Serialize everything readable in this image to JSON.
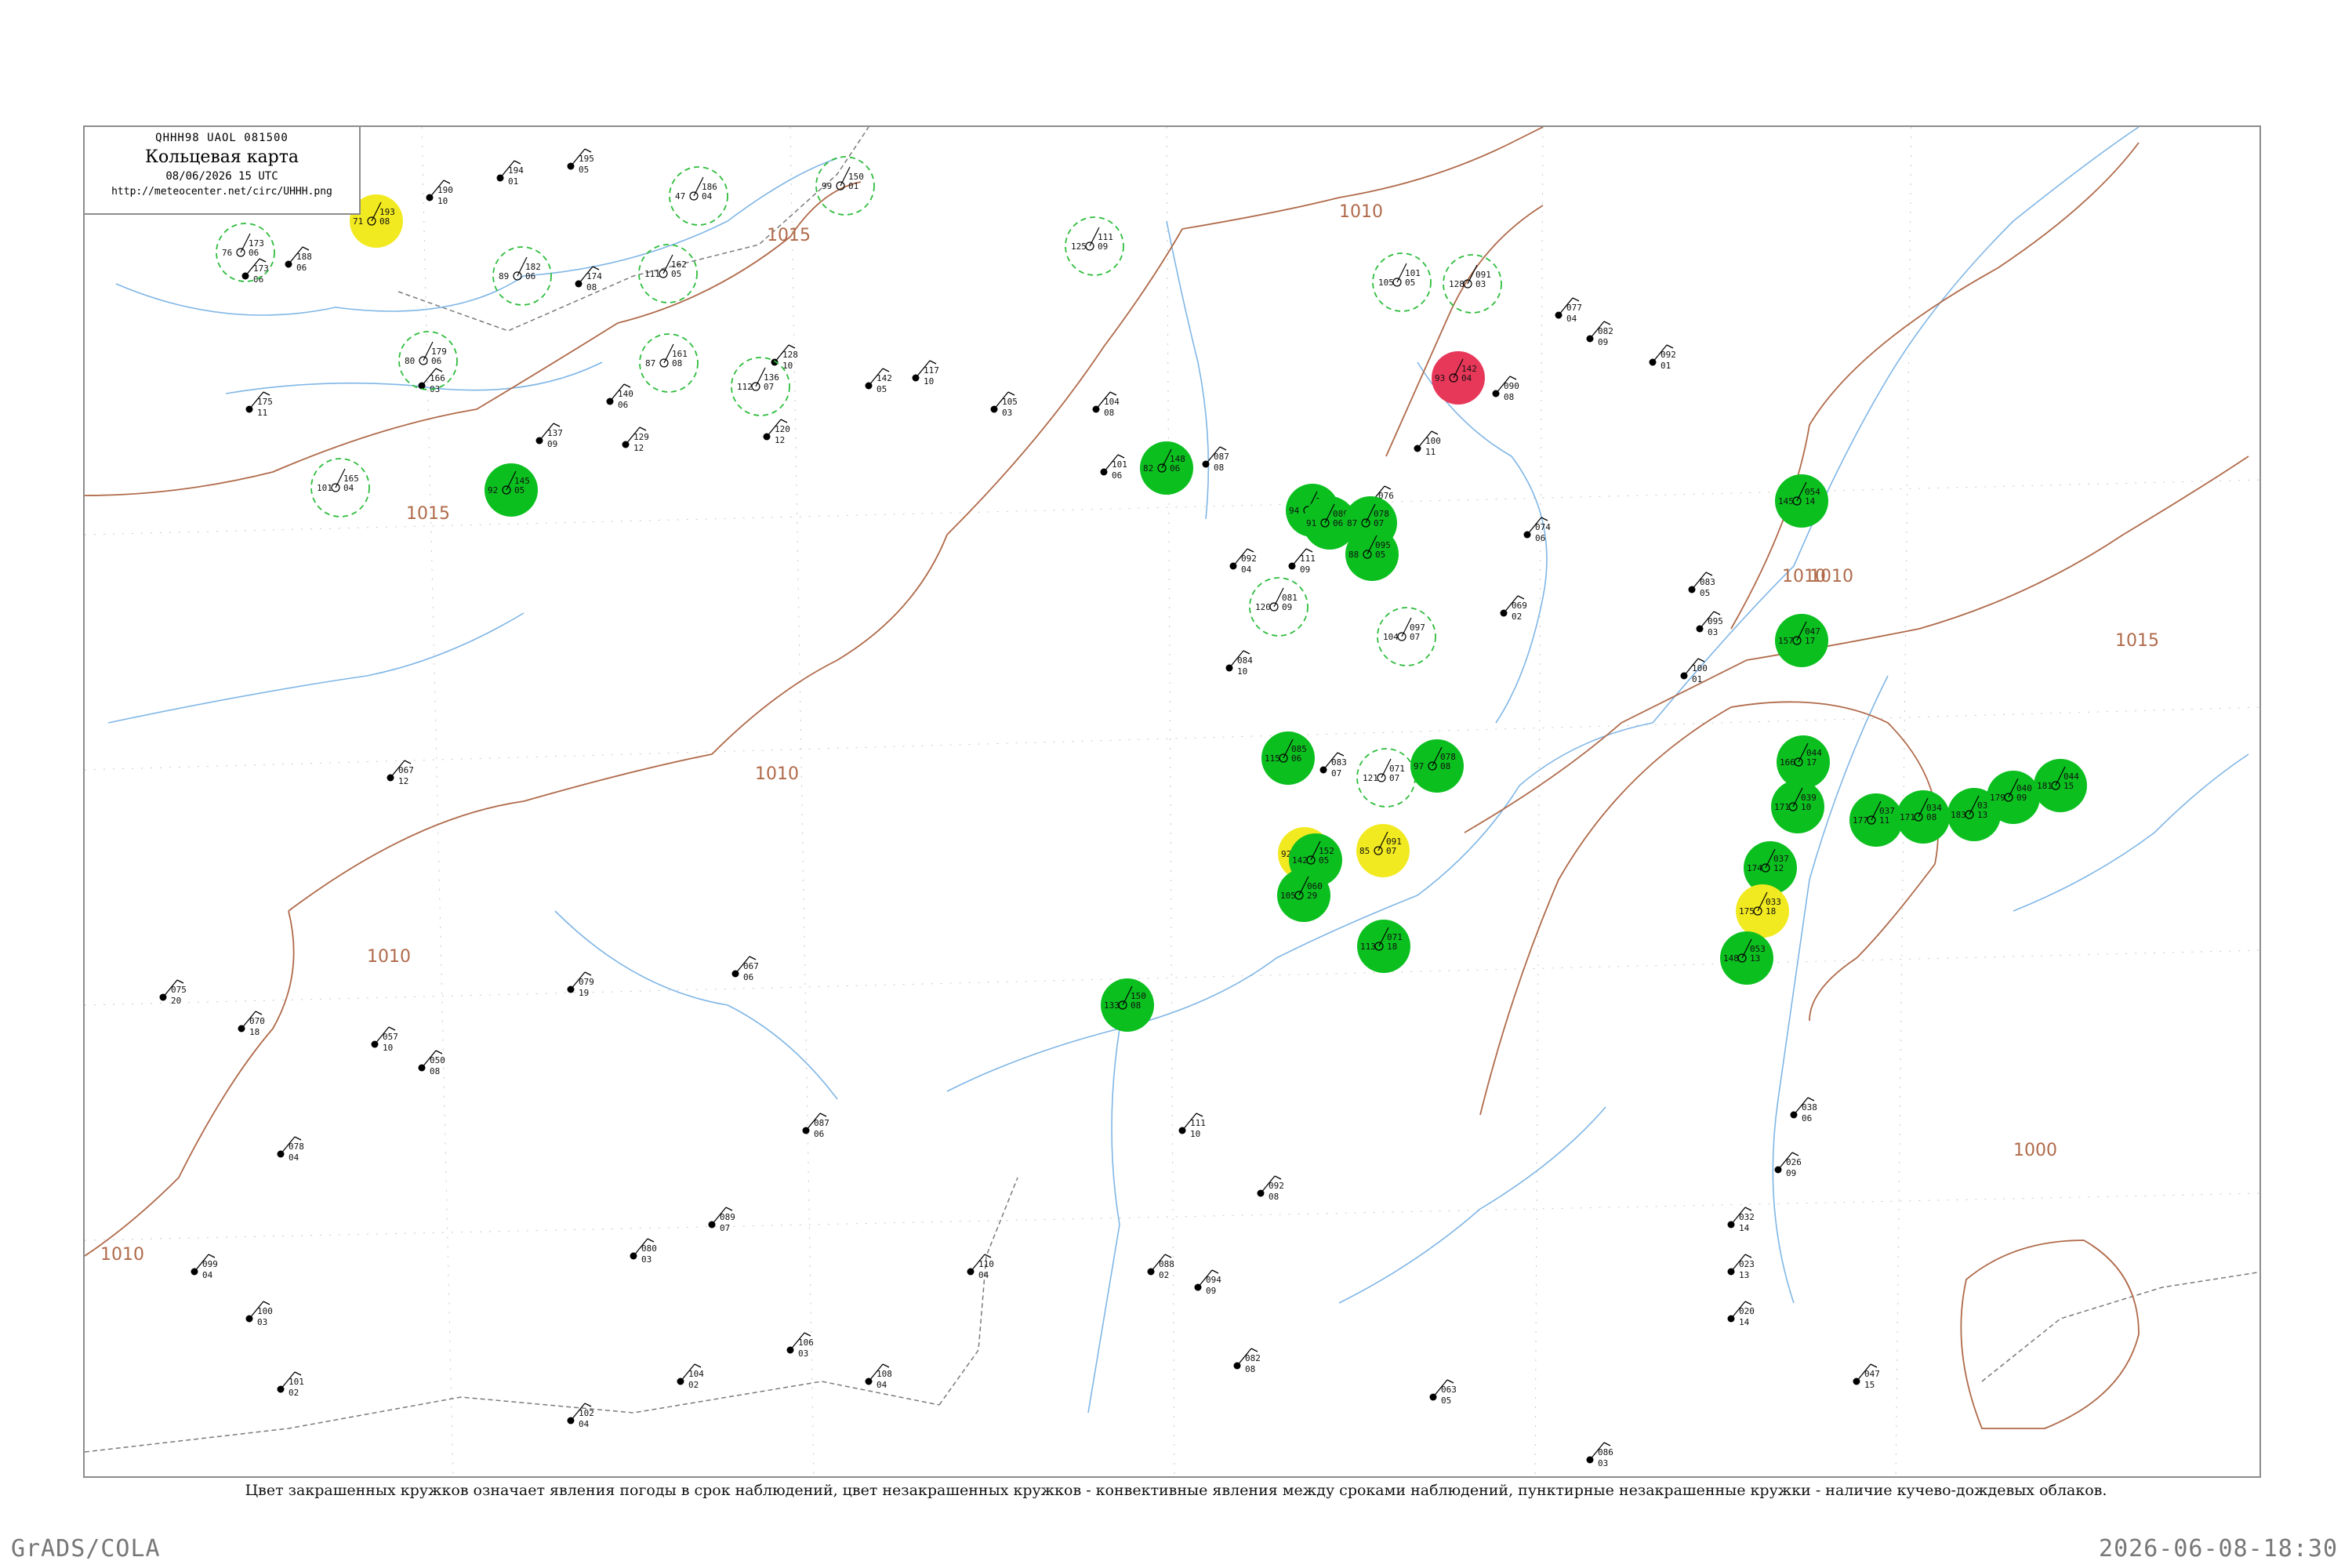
{
  "header": {
    "code": "QHHH98  UAOL  081500",
    "title": "Кольцевая карта",
    "datetime": "08/06/2026 15 UTC",
    "url": "http://meteocenter.net/circ/UHHH.png"
  },
  "footnote": "Цвет закрашенных кружков означает явления погоды в срок наблюдений, цвет незакрашенных кружков - конвективные явления между сроками наблюдений, пунктирные незакрашенные кружки - наличие кучево-дождевых облаков.",
  "footer": {
    "left": "GrADS/COLA",
    "right": "2026-06-08-18:30"
  },
  "colors": {
    "isobar": "#b06a4a",
    "river": "#7fb6e6",
    "border": "#7a7a7a",
    "precip_green": "#0bbf1f",
    "haze_yellow": "#f2ea20",
    "thunder_red": "#e8385a",
    "cb_dashed": "#2ebd3c"
  },
  "isobar_labels": [
    "1015",
    "1015",
    "1010",
    "1010",
    "1010",
    "1010",
    "1010",
    "1015",
    "1000",
    "1010"
  ],
  "stations": [
    {
      "pressure": "193",
      "temp": "08",
      "dew": "71",
      "state": "haze"
    },
    {
      "pressure": "173",
      "temp": "06",
      "dew": "76",
      "state": "cb"
    },
    {
      "pressure": "186",
      "temp": "04",
      "dew": "47",
      "state": "cb"
    },
    {
      "pressure": "150",
      "temp": "01",
      "dew": "99",
      "state": "cb"
    },
    {
      "pressure": "111",
      "temp": "09",
      "dew": "125",
      "state": "cb"
    },
    {
      "pressure": "101",
      "temp": "05",
      "dew": "105",
      "state": "cb"
    },
    {
      "pressure": "091",
      "temp": "03",
      "dew": "128",
      "state": "cb"
    },
    {
      "pressure": "179",
      "temp": "06",
      "dew": "80",
      "state": "cb"
    },
    {
      "pressure": "182",
      "temp": "06",
      "dew": "89",
      "state": "cb"
    },
    {
      "pressure": "162",
      "temp": "05",
      "dew": "111",
      "state": "cb"
    },
    {
      "pressure": "161",
      "temp": "08",
      "dew": "87",
      "state": "cb"
    },
    {
      "pressure": "136",
      "temp": "07",
      "dew": "112",
      "state": "cb"
    },
    {
      "pressure": "165",
      "temp": "04",
      "dew": "101",
      "state": "cb"
    },
    {
      "pressure": "142",
      "temp": "04",
      "dew": "93",
      "state": "thunder"
    },
    {
      "pressure": "145",
      "temp": "05",
      "dew": "92",
      "state": "precip"
    },
    {
      "pressure": "148",
      "temp": "06",
      "dew": "82",
      "state": "precip"
    },
    {
      "pressure": "149",
      "temp": "04",
      "dew": "94",
      "state": "precip"
    },
    {
      "pressure": "089",
      "temp": "06",
      "dew": "91",
      "state": "precip"
    },
    {
      "pressure": "078",
      "temp": "07",
      "dew": "87",
      "state": "precip"
    },
    {
      "pressure": "081",
      "temp": "09",
      "dew": "120",
      "state": "cb"
    },
    {
      "pressure": "097",
      "temp": "07",
      "dew": "104",
      "state": "cb"
    },
    {
      "pressure": "095",
      "temp": "05",
      "dew": "88",
      "state": "precip"
    },
    {
      "pressure": "085",
      "temp": "06",
      "dew": "115",
      "state": "precip"
    },
    {
      "pressure": "071",
      "temp": "07",
      "dew": "121",
      "state": "cb"
    },
    {
      "pressure": "078",
      "temp": "08",
      "dew": "97",
      "state": "precip"
    },
    {
      "pressure": "098",
      "temp": "05",
      "dew": "92",
      "state": "haze"
    },
    {
      "pressure": "091",
      "temp": "07",
      "dew": "85",
      "state": "haze"
    },
    {
      "pressure": "152",
      "temp": "05",
      "dew": "142",
      "state": "precip"
    },
    {
      "pressure": "150",
      "temp": "08",
      "dew": "133",
      "state": "precip"
    },
    {
      "pressure": "060",
      "temp": "29",
      "dew": "105",
      "state": "precip"
    },
    {
      "pressure": "071",
      "temp": "18",
      "dew": "113",
      "state": "precip"
    },
    {
      "pressure": "054",
      "temp": "14",
      "dew": "145",
      "state": "precip"
    },
    {
      "pressure": "047",
      "temp": "17",
      "dew": "157",
      "state": "precip"
    },
    {
      "pressure": "044",
      "temp": "17",
      "dew": "166",
      "state": "precip"
    },
    {
      "pressure": "039",
      "temp": "10",
      "dew": "171",
      "state": "precip"
    },
    {
      "pressure": "037",
      "temp": "11",
      "dew": "177",
      "state": "precip"
    },
    {
      "pressure": "034",
      "temp": "08",
      "dew": "171",
      "state": "precip"
    },
    {
      "pressure": "030",
      "temp": "13",
      "dew": "183",
      "state": "precip"
    },
    {
      "pressure": "040",
      "temp": "09",
      "dew": "179",
      "state": "precip"
    },
    {
      "pressure": "044",
      "temp": "15",
      "dew": "181",
      "state": "precip"
    },
    {
      "pressure": "037",
      "temp": "12",
      "dew": "174",
      "state": "precip"
    },
    {
      "pressure": "033",
      "temp": "18",
      "dew": "175",
      "state": "haze"
    },
    {
      "pressure": "053",
      "temp": "13",
      "dew": "148",
      "state": "precip"
    }
  ],
  "plain_stations": [
    {
      "p": "195",
      "t": "05"
    },
    {
      "p": "194",
      "t": "01"
    },
    {
      "p": "190",
      "t": "10"
    },
    {
      "p": "188",
      "t": "06"
    },
    {
      "p": "173",
      "t": "06"
    },
    {
      "p": "174",
      "t": "08"
    },
    {
      "p": "166",
      "t": "03"
    },
    {
      "p": "175",
      "t": "11"
    },
    {
      "p": "140",
      "t": "06"
    },
    {
      "p": "137",
      "t": "09"
    },
    {
      "p": "129",
      "t": "12"
    },
    {
      "p": "120",
      "t": "12"
    },
    {
      "p": "128",
      "t": "10"
    },
    {
      "p": "142",
      "t": "05"
    },
    {
      "p": "117",
      "t": "10"
    },
    {
      "p": "105",
      "t": "03"
    },
    {
      "p": "104",
      "t": "08"
    },
    {
      "p": "101",
      "t": "06"
    },
    {
      "p": "087",
      "t": "08"
    },
    {
      "p": "092",
      "t": "04"
    },
    {
      "p": "111",
      "t": "09"
    },
    {
      "p": "076",
      "t": "06"
    },
    {
      "p": "084",
      "t": "10"
    },
    {
      "p": "083",
      "t": "07"
    },
    {
      "p": "100",
      "t": "11"
    },
    {
      "p": "090",
      "t": "08"
    },
    {
      "p": "077",
      "t": "04"
    },
    {
      "p": "083",
      "t": "05"
    },
    {
      "p": "095",
      "t": "03"
    },
    {
      "p": "092",
      "t": "01"
    },
    {
      "p": "100",
      "t": "01"
    },
    {
      "p": "082",
      "t": "09"
    },
    {
      "p": "074",
      "t": "06"
    },
    {
      "p": "069",
      "t": "02"
    },
    {
      "p": "067",
      "t": "12"
    },
    {
      "p": "075",
      "t": "20"
    },
    {
      "p": "070",
      "t": "18"
    },
    {
      "p": "057",
      "t": "10"
    },
    {
      "p": "050",
      "t": "08"
    },
    {
      "p": "079",
      "t": "19"
    },
    {
      "p": "067",
      "t": "06"
    },
    {
      "p": "087",
      "t": "06"
    },
    {
      "p": "089",
      "t": "07"
    },
    {
      "p": "080",
      "t": "03"
    },
    {
      "p": "078",
      "t": "04"
    },
    {
      "p": "099",
      "t": "04"
    },
    {
      "p": "100",
      "t": "03"
    },
    {
      "p": "101",
      "t": "02"
    },
    {
      "p": "102",
      "t": "04"
    },
    {
      "p": "104",
      "t": "02"
    },
    {
      "p": "106",
      "t": "03"
    },
    {
      "p": "108",
      "t": "04"
    },
    {
      "p": "110",
      "t": "04"
    },
    {
      "p": "088",
      "t": "02"
    },
    {
      "p": "111",
      "t": "10"
    },
    {
      "p": "094",
      "t": "09"
    },
    {
      "p": "082",
      "t": "08"
    },
    {
      "p": "092",
      "t": "08"
    },
    {
      "p": "063",
      "t": "05"
    },
    {
      "p": "086",
      "t": "03"
    },
    {
      "p": "026",
      "t": "09"
    },
    {
      "p": "038",
      "t": "06"
    },
    {
      "p": "032",
      "t": "14"
    },
    {
      "p": "023",
      "t": "13"
    },
    {
      "p": "020",
      "t": "14"
    },
    {
      "p": "047",
      "t": "15"
    }
  ]
}
